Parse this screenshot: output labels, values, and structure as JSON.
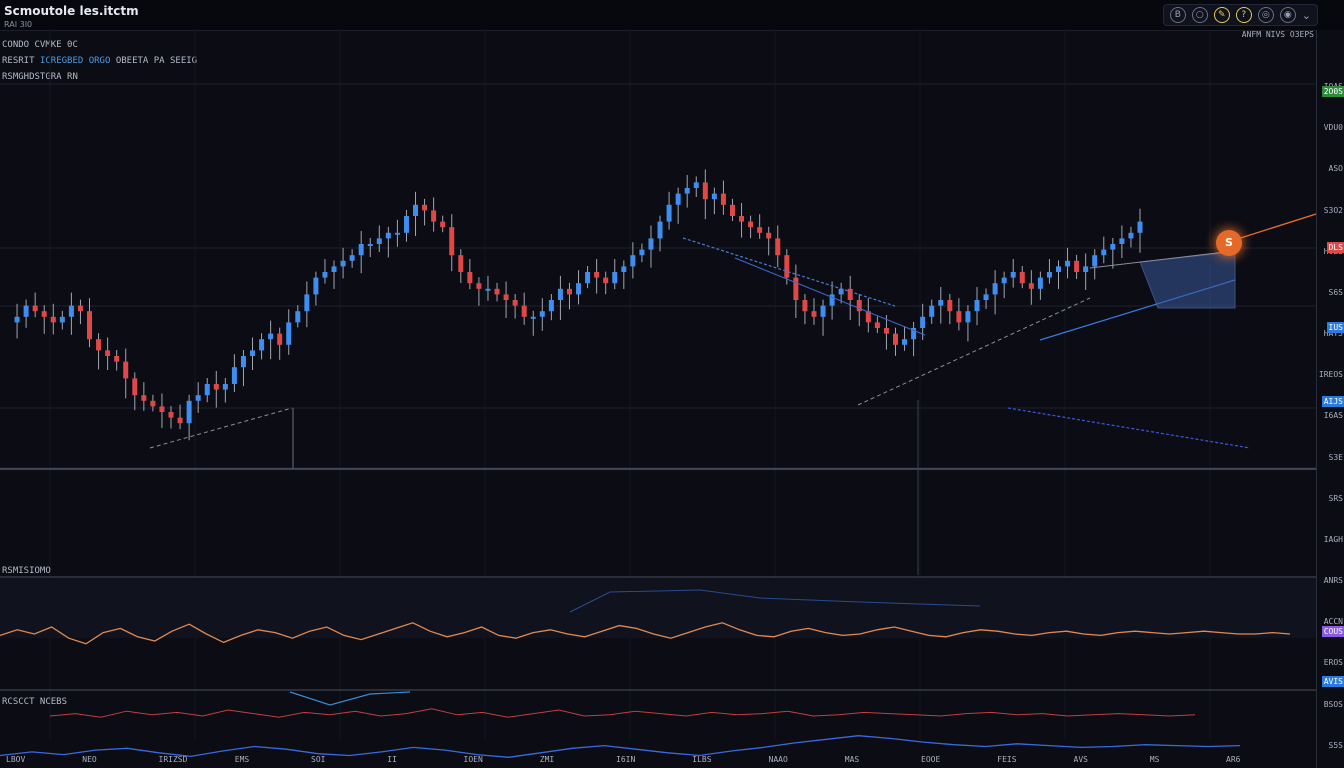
{
  "header": {
    "title": "Scmoutole les.itctm",
    "subtitle": "RAI  3I0"
  },
  "toolbar": {
    "icons": [
      "b-icon",
      "circle-icon",
      "brush-icon",
      "help-icon",
      "settings-icon",
      "shield-icon",
      "chevron-icon"
    ],
    "glyphs": [
      "B",
      "○",
      "✎",
      "?",
      "◎",
      "◉",
      "⌄"
    ]
  },
  "legend": {
    "line1": "CONDO CVMKE 0C",
    "line2_a": "RESRIT",
    "line2_hl": "ICREGBED ORGO",
    "line2_b": "OBEETA  PA  SEEIG",
    "line3": "RSMGHDSTGRA RN"
  },
  "axis": {
    "header": "ANFM NIVS   O3EPS",
    "ticks": [
      "IOAS",
      "VDU0",
      "ASO",
      "S3O2",
      "HOLS",
      "S6S",
      "HAT5",
      "IREOS",
      "I6AS",
      "S3E",
      "SRS",
      "IAGH",
      "ANRS",
      "ACCN",
      "EROS",
      "BSOS",
      "S5S"
    ],
    "tags": [
      {
        "text": "2O0S",
        "color": "#2f8a3c"
      },
      {
        "text": "DLS",
        "color": "#d84b4b"
      },
      {
        "text": "IUS",
        "color": "#2a7be0"
      },
      {
        "text": "AIJS",
        "color": "#2a7be0"
      },
      {
        "text": "COUS",
        "color": "#8a5ae0"
      },
      {
        "text": "AVIS",
        "color": "#2a7be0"
      }
    ]
  },
  "marker": {
    "text": "S"
  },
  "panes": {
    "osc1": "RSMISIOMO",
    "osc2": "RCSCCT  NCEBS"
  },
  "time_labels": [
    "LBOV",
    "NEO",
    "IRIZSD",
    "EMS",
    "SOI",
    "II",
    "IOEN",
    "ZMI",
    "I6IN",
    "ILBS",
    "NAAO",
    "MAS",
    "EOOE",
    "FEIS",
    "AVS",
    "MS",
    "AR6"
  ],
  "colors": {
    "up": "#3d8ef0",
    "down": "#e04848",
    "wick": "#c8ccd8",
    "osc_orange": "#e08a50",
    "osc_red": "#c04040",
    "osc_blue": "#3a6ae0",
    "accent": "#e56a28"
  },
  "chart_data": {
    "type": "candlestick",
    "title": "Scmoutole les.itctm",
    "price_axis": [
      0,
      100
    ],
    "price_series": [
      46,
      47,
      49,
      48,
      47,
      46,
      47,
      49,
      48,
      43,
      41,
      40,
      39,
      36,
      33,
      32,
      31,
      30,
      29,
      28,
      32,
      33,
      35,
      34,
      35,
      38,
      40,
      41,
      43,
      44,
      42,
      46,
      48,
      51,
      54,
      55,
      56,
      57,
      58,
      60,
      60,
      61,
      62,
      62,
      65,
      67,
      66,
      64,
      63,
      58,
      55,
      53,
      52,
      52,
      51,
      50,
      49,
      47,
      47,
      48,
      50,
      52,
      51,
      53,
      55,
      54,
      53,
      55,
      56,
      58,
      59,
      61,
      64,
      67,
      69,
      70,
      71,
      68,
      69,
      67,
      65,
      64,
      63,
      62,
      61,
      58,
      54,
      50,
      48,
      47,
      49,
      51,
      52,
      50,
      48,
      46,
      45,
      44,
      42,
      43,
      45,
      47,
      49,
      50,
      48,
      46,
      48,
      50,
      51,
      53,
      54,
      55,
      53,
      52,
      54,
      55,
      56,
      57,
      55,
      56,
      58,
      59,
      60,
      61,
      62,
      64
    ],
    "oscillator_orange": [
      44,
      48,
      45,
      50,
      42,
      38,
      46,
      49,
      43,
      40,
      47,
      52,
      45,
      39,
      44,
      48,
      46,
      42,
      47,
      50,
      44,
      41,
      45,
      49,
      53,
      47,
      43,
      46,
      50,
      44,
      42,
      46,
      48,
      45,
      43,
      47,
      51,
      49,
      45,
      42,
      46,
      50,
      53,
      48,
      44,
      43,
      47,
      49,
      46,
      44,
      45,
      48,
      50,
      47,
      44,
      43,
      46,
      48,
      47,
      45,
      44,
      46,
      47,
      45,
      44,
      46,
      47,
      46,
      45,
      46,
      47,
      46,
      45,
      45,
      46,
      45
    ],
    "oscillator_red": [
      20,
      22,
      19,
      24,
      21,
      23,
      20,
      25,
      22,
      19,
      23,
      21,
      24,
      20,
      22,
      26,
      21,
      23,
      19,
      22,
      25,
      20,
      21,
      24,
      22,
      20,
      23,
      21,
      22,
      24,
      20,
      21,
      23,
      22,
      21,
      20,
      22,
      23,
      21,
      22,
      20,
      21,
      22,
      21,
      20,
      21
    ],
    "oscillator_blue": [
      30,
      34,
      31,
      36,
      38,
      33,
      29,
      35,
      40,
      37,
      32,
      30,
      34,
      39,
      36,
      31,
      28,
      33,
      38,
      41,
      37,
      33,
      30,
      35,
      39,
      44,
      48,
      52,
      49,
      45,
      42,
      40,
      43,
      41,
      39,
      40,
      42,
      41,
      40,
      41
    ]
  }
}
